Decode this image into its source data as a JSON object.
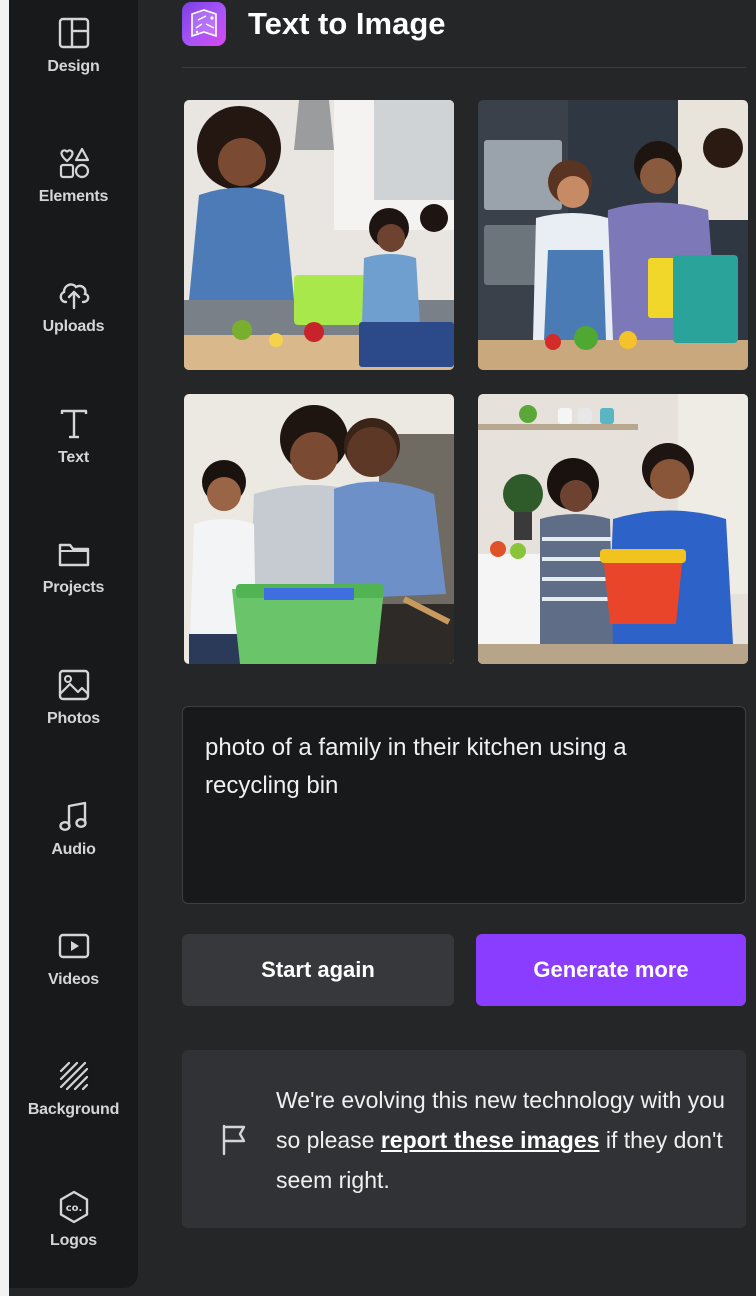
{
  "sidebar": {
    "items": [
      {
        "label": "Design",
        "icon": "layout-icon"
      },
      {
        "label": "Elements",
        "icon": "shapes-icon"
      },
      {
        "label": "Uploads",
        "icon": "cloud-upload-icon"
      },
      {
        "label": "Text",
        "icon": "text-icon"
      },
      {
        "label": "Projects",
        "icon": "folder-icon"
      },
      {
        "label": "Photos",
        "icon": "image-icon"
      },
      {
        "label": "Audio",
        "icon": "music-note-icon"
      },
      {
        "label": "Videos",
        "icon": "play-icon"
      },
      {
        "label": "Background",
        "icon": "hatch-pattern-icon"
      },
      {
        "label": "Logos",
        "icon": "co-logo-icon"
      }
    ]
  },
  "panel": {
    "title": "Text to Image",
    "images": [
      {
        "id": "result-1",
        "description": "family cooking, green bin"
      },
      {
        "id": "result-2",
        "description": "family with yellow and teal bins"
      },
      {
        "id": "result-3",
        "description": "family sorting green bin"
      },
      {
        "id": "result-4",
        "description": "mother and child with orange bucket"
      }
    ],
    "prompt_text": "photo of a family in their kitchen using a recycling bin",
    "start_again_label": "Start again",
    "generate_more_label": "Generate more",
    "notice": {
      "before": "We're evolving this new technology with you so please ",
      "link": "report these images",
      "after": " if they don't seem right."
    }
  },
  "colors": {
    "accent": "#8b3dff",
    "sidebar_bg": "#18191b",
    "panel_bg": "#252628"
  }
}
